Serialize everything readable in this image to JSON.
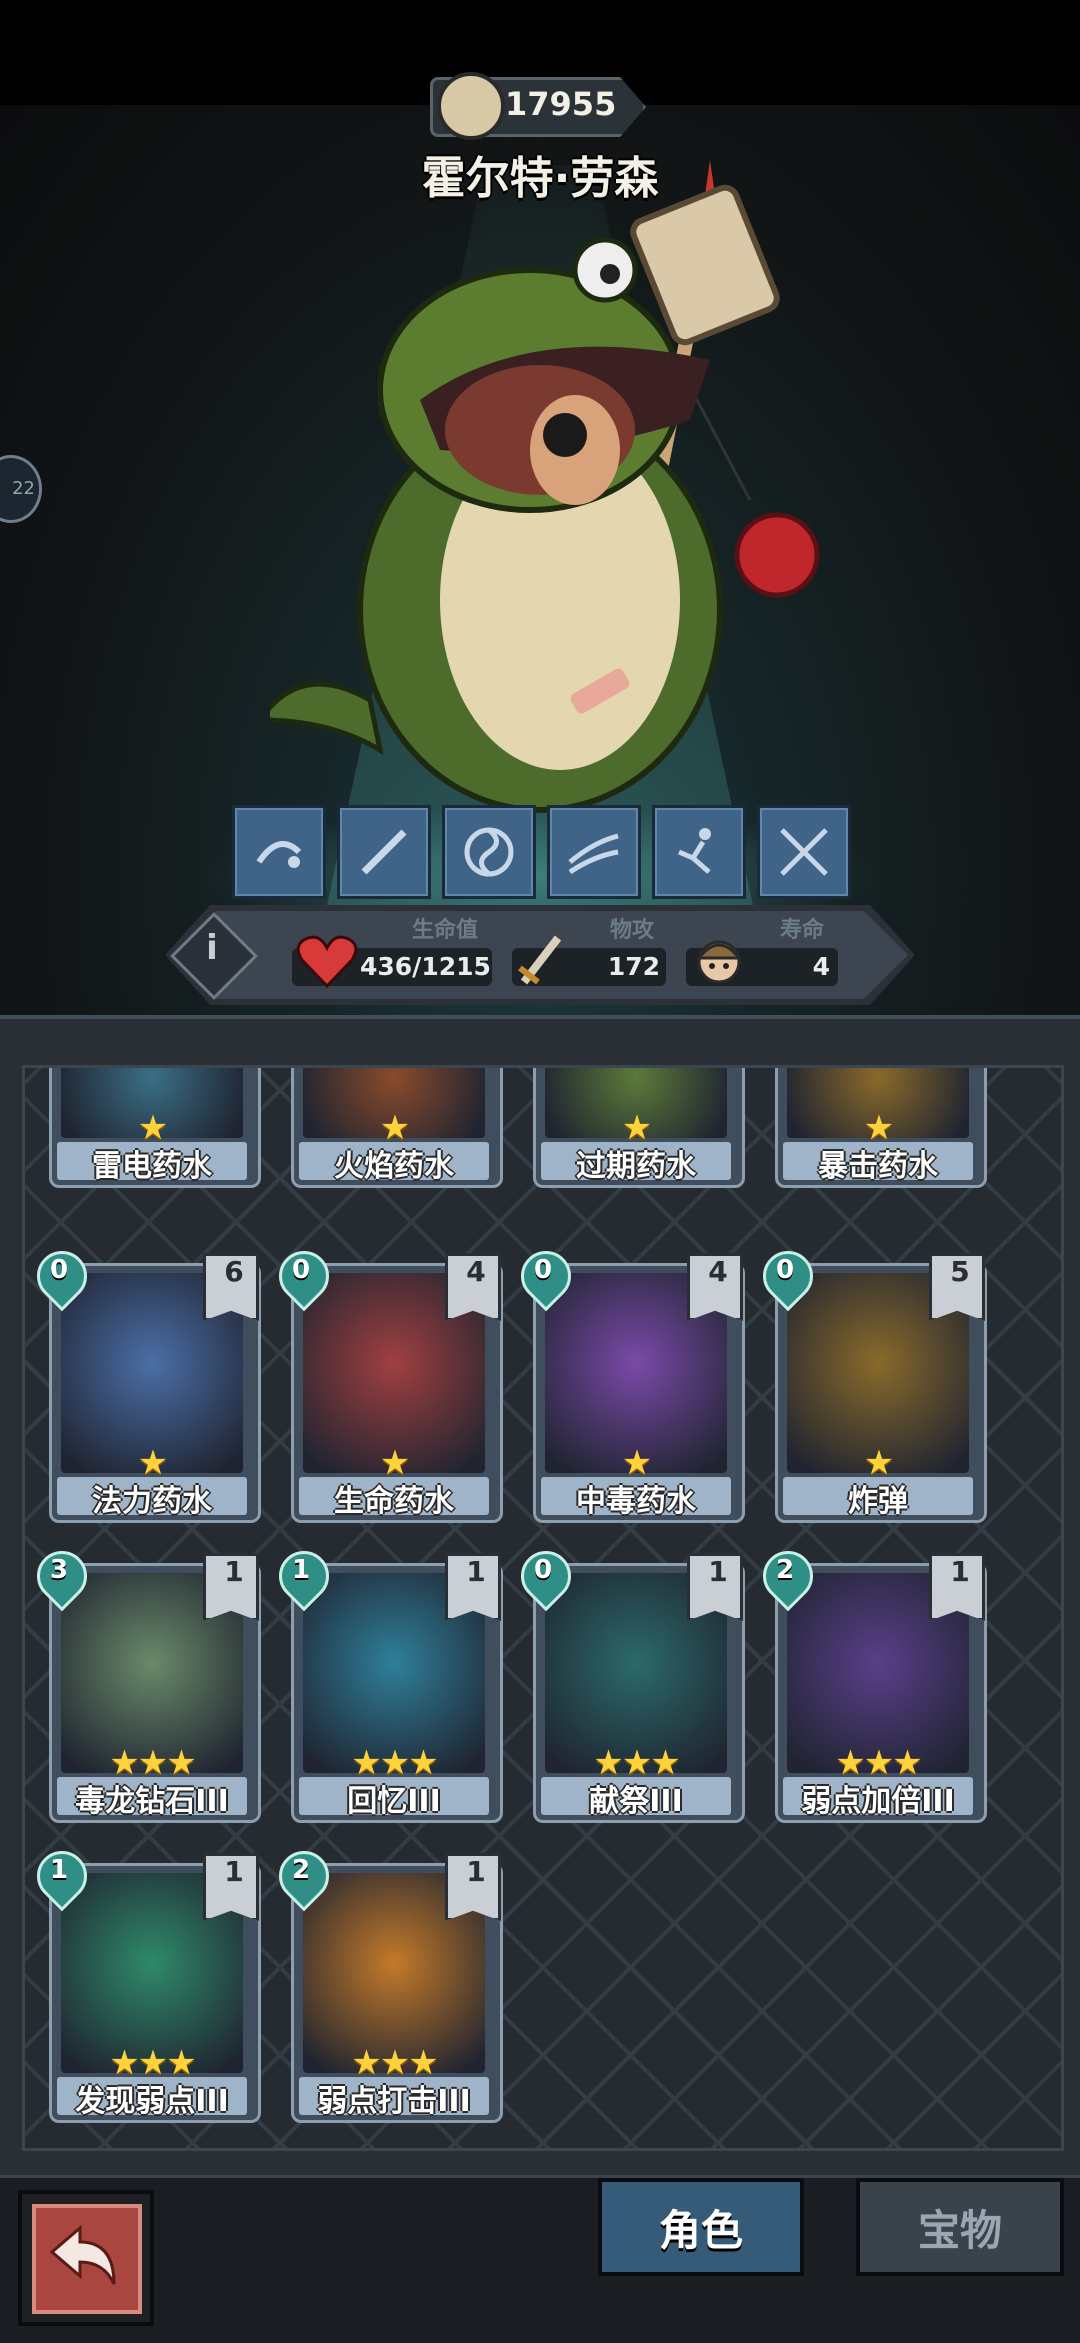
{
  "hero": {
    "power": "17955",
    "name": "霍尔特·劳森",
    "side_badge": "22"
  },
  "skills": [
    "fish-hook-skill-icon",
    "blade-skill-icon",
    "yin-yang-skill-icon",
    "wind-slash-skill-icon",
    "kick-skill-icon",
    "crossed-swords-skill-icon"
  ],
  "stats": {
    "hp_label": "生命值",
    "hp_value": "436/1215",
    "attack_label": "物攻",
    "attack_value": "172",
    "life_label": "寿命",
    "life_value": "4"
  },
  "cards": {
    "row0": [
      {
        "name": "雷电药水",
        "stars": "★",
        "art_color": "#3b6f86"
      },
      {
        "name": "火焰药水",
        "stars": "★",
        "art_color": "#8a4b2b"
      },
      {
        "name": "过期药水",
        "stars": "★",
        "art_color": "#5c7a3a"
      },
      {
        "name": "暴击药水",
        "stars": "★",
        "art_color": "#8a6a2b"
      }
    ],
    "row1": [
      {
        "name": "法力药水",
        "cost": "0",
        "count": "6",
        "stars": "★",
        "art_color": "#4b6fa8"
      },
      {
        "name": "生命药水",
        "cost": "0",
        "count": "4",
        "stars": "★",
        "art_color": "#a04040"
      },
      {
        "name": "中毒药水",
        "cost": "0",
        "count": "4",
        "stars": "★",
        "art_color": "#7a4aa8"
      },
      {
        "name": "炸弹",
        "cost": "0",
        "count": "5",
        "stars": "★",
        "art_color": "#8a6a2b"
      }
    ],
    "row2": [
      {
        "name": "毒龙钻石III",
        "cost": "3",
        "count": "1",
        "stars": "★★★",
        "art_color": "#6a8a6a"
      },
      {
        "name": "回忆III",
        "cost": "1",
        "count": "1",
        "stars": "★★★",
        "art_color": "#2f7f9a"
      },
      {
        "name": "献祭III",
        "cost": "0",
        "count": "1",
        "stars": "★★★",
        "art_color": "#2b6a6a"
      },
      {
        "name": "弱点加倍III",
        "cost": "2",
        "count": "1",
        "stars": "★★★",
        "art_color": "#5a3f8a"
      }
    ],
    "row3": [
      {
        "name": "发现弱点III",
        "cost": "1",
        "count": "1",
        "stars": "★★★",
        "art_color": "#2f8a6a"
      },
      {
        "name": "弱点打击III",
        "cost": "2",
        "count": "1",
        "stars": "★★★",
        "art_color": "#c47a2a"
      }
    ]
  },
  "bottom": {
    "tab_role": "角色",
    "tab_treasure": "宝物"
  }
}
